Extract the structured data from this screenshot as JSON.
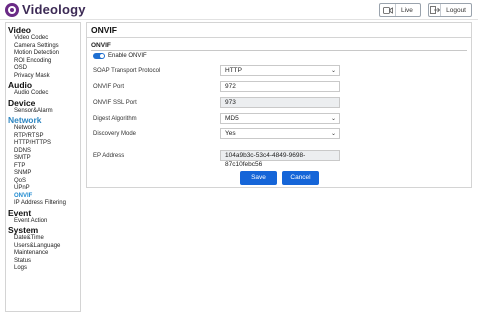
{
  "brand": {
    "name": "Videology"
  },
  "header": {
    "live_label": "Live",
    "logout_label": "Logout"
  },
  "sidebar": {
    "sections": [
      {
        "title": "Video",
        "items": [
          "Video Codec",
          "Camera Settings",
          "Motion Detection",
          "ROI Encoding",
          "OSD",
          "Privacy Mask"
        ]
      },
      {
        "title": "Audio",
        "items": [
          "Audio Codec"
        ]
      },
      {
        "title": "Device",
        "items": [
          "Sensor&Alarm"
        ]
      },
      {
        "title": "Network",
        "items": [
          "Network",
          "RTP/RTSP",
          "HTTP/HTTPS",
          "DDNS",
          "SMTP",
          "FTP",
          "SNMP",
          "QoS",
          "UPnP",
          "ONVIF",
          "IP Address Filtering"
        ]
      },
      {
        "title": "Event",
        "items": [
          "Event Action"
        ]
      },
      {
        "title": "System",
        "items": [
          "Date&Time",
          "Users&Language",
          "Maintenance",
          "Status",
          "Logs"
        ]
      }
    ],
    "active_section": "Network",
    "active_item": "ONVIF"
  },
  "main": {
    "title": "ONVIF",
    "subtitle": "ONVIF",
    "enable_label": "Enable ONVIF",
    "enable_on": true,
    "fields": {
      "soap_label": "SOAP Transport Protocol",
      "soap_value": "HTTP",
      "port_label": "ONVIF Port",
      "port_value": "972",
      "ssl_label": "ONVIF SSL Port",
      "ssl_value": "973",
      "digest_label": "Digest Algorithm",
      "digest_value": "MD5",
      "discovery_label": "Discovery Mode",
      "discovery_value": "Yes",
      "ep_label": "EP Address",
      "ep_value": "104a9b3c-53c4-4849-9698-87c10febc56"
    },
    "save_label": "Save",
    "cancel_label": "Cancel"
  },
  "colors": {
    "accent": "#1565d8",
    "active_nav": "#1f8ad0",
    "brand": "#6a2a86"
  }
}
